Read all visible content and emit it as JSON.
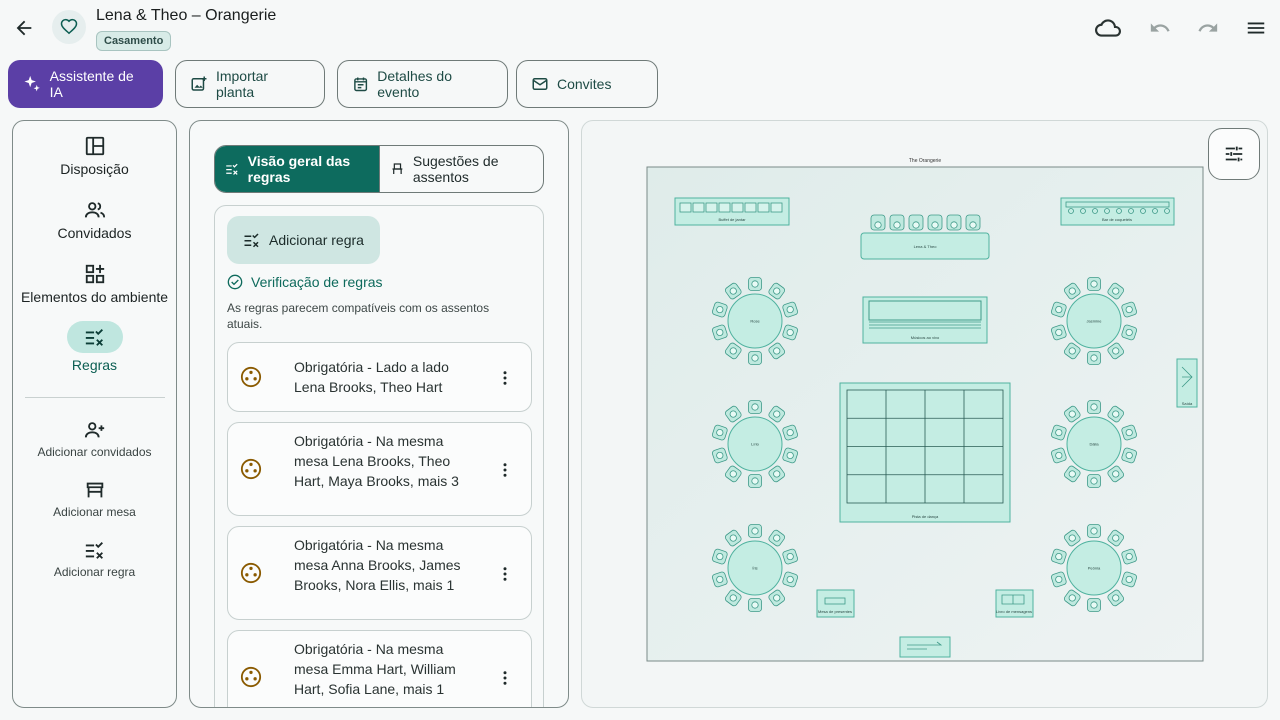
{
  "header": {
    "title": "Lena & Theo – Orangerie",
    "badge": "Casamento"
  },
  "actions": {
    "ai": "Assistente de IA",
    "import": "Importar planta",
    "details": "Detalhes do evento",
    "invites": "Convites"
  },
  "nav": {
    "items": [
      {
        "label": "Disposição"
      },
      {
        "label": "Convidados"
      },
      {
        "label": "Elementos do ambiente"
      },
      {
        "label": "Regras"
      }
    ],
    "quick": [
      {
        "label": "Adicionar convidados"
      },
      {
        "label": "Adicionar mesa"
      },
      {
        "label": "Adicionar regra"
      }
    ]
  },
  "rules_panel": {
    "tab_overview": "Visão geral das regras",
    "tab_suggestions": "Sugestões de assentos",
    "add_rule": "Adicionar regra",
    "check_title": "Verificação de regras",
    "check_desc": "As regras parecem compatíveis com os assentos atuais.",
    "rules": [
      {
        "text": "Obrigatória - Lado a lado\nLena Brooks, Theo Hart"
      },
      {
        "text": "Obrigatória - Na mesma mesa\nLena Brooks, Theo Hart, Maya Brooks, mais 3"
      },
      {
        "text": "Obrigatória - Na mesma mesa\nAnna Brooks, James Brooks, Nora Ellis, mais 1"
      },
      {
        "text": "Obrigatória - Na mesma mesa\nEmma Hart, William Hart, Sofia Lane, mais 1"
      }
    ]
  },
  "floorplan": {
    "venue": "The Orangerie",
    "labels": {
      "buffet": "Buffet de jantar",
      "head": "Lena & Theo",
      "cocktail": "Bar de coquetéis",
      "music": "Músicos ao vivo",
      "dance": "Pista de dança",
      "exit": "Saída",
      "gift": "Mesa de presentes",
      "guestbook": "Livro de mensagens"
    },
    "tables": [
      {
        "name": "Rose"
      },
      {
        "name": "Jasmine"
      },
      {
        "name": "Lírio"
      },
      {
        "name": "Dália"
      },
      {
        "name": "Íris"
      },
      {
        "name": "Peônia"
      }
    ]
  },
  "colors": {
    "accent": "#0d6b5e",
    "ai": "#5b3fa6",
    "element_fill": "#c4ede3",
    "element_stroke": "#4fb29f"
  }
}
